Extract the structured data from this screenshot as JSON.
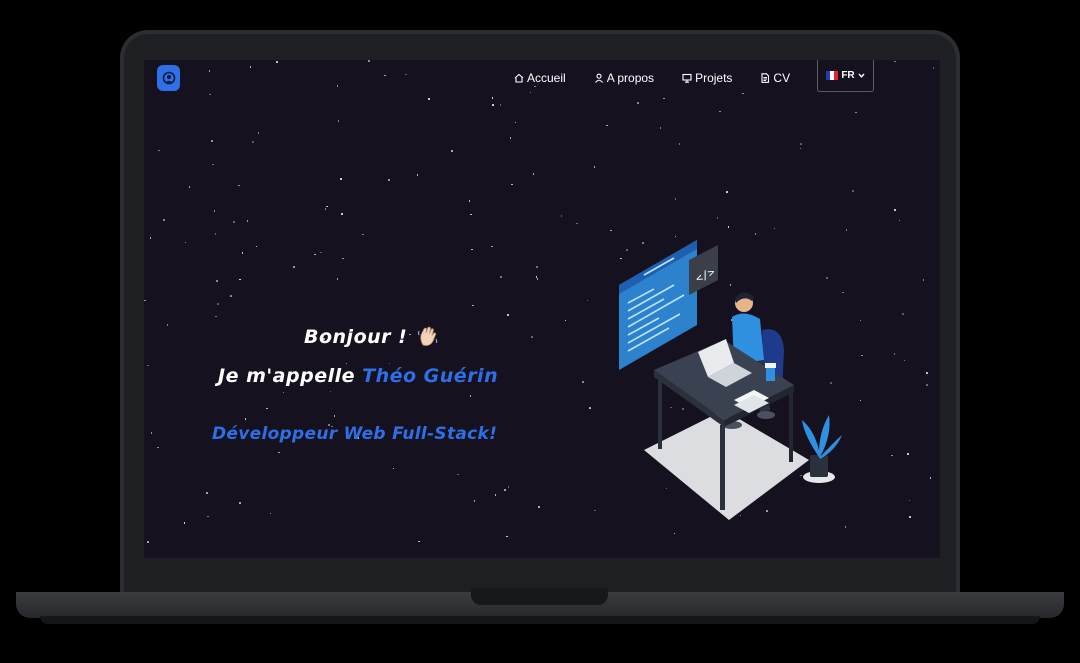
{
  "nav": {
    "logo_icon": "brand-logo-icon",
    "items": [
      {
        "label": "Accueil",
        "icon": "home-icon"
      },
      {
        "label": "A propos",
        "icon": "user-icon"
      },
      {
        "label": "Projets",
        "icon": "monitor-icon"
      },
      {
        "label": "CV",
        "icon": "document-icon"
      }
    ],
    "language": {
      "label": "FR",
      "icon": "france-flag-icon",
      "caret": "chevron-down-icon"
    }
  },
  "hero": {
    "greeting": "Bonjour !",
    "wave_icon": "waving-hand-icon",
    "intro": "Je m'appelle",
    "name": "Théo Guérin",
    "role": "Développeur Web Full-Stack!"
  },
  "colors": {
    "accent": "#2d6fe6",
    "background": "#16111f",
    "text": "#ffffff"
  }
}
